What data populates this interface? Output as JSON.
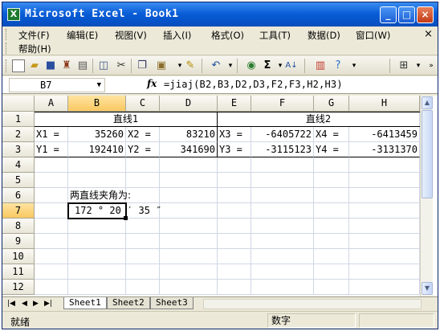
{
  "window": {
    "title": "Microsoft Excel - Book1",
    "app_icon": "X",
    "minimize_icon": "_",
    "maximize_icon": "□",
    "close_icon": "×"
  },
  "menubar": {
    "row1": [
      {
        "label": "文件(F)"
      },
      {
        "label": "编辑(E)"
      },
      {
        "label": "视图(V)"
      },
      {
        "label": "插入(I)"
      },
      {
        "label": "格式(O)"
      },
      {
        "label": "工具(T)"
      },
      {
        "label": "数据(D)"
      },
      {
        "label": "窗口(W)"
      }
    ],
    "row2": [
      {
        "label": "帮助(H)"
      }
    ],
    "close_doc": "×"
  },
  "toolbar": {
    "icons": [
      "new-icon",
      "open-icon",
      "save-icon",
      "permission-icon",
      "print-icon",
      "print-preview-icon",
      "research-icon",
      "copy-icon",
      "paste-icon",
      "format-painter-icon",
      "undo-icon",
      "hyperlink-icon",
      "autosum-icon",
      "sort-ascending-icon",
      "chart-wizard-icon",
      "help-icon",
      "borders-icon"
    ]
  },
  "formula_bar": {
    "name_box": "B7",
    "fx": "fx",
    "formula": "=jiaj(B2,B3,D2,D3,F2,F3,H2,H3)"
  },
  "grid": {
    "columns": [
      "A",
      "B",
      "C",
      "D",
      "E",
      "F",
      "G",
      "H"
    ],
    "rows": [
      "1",
      "2",
      "3",
      "4",
      "5",
      "6",
      "7",
      "8",
      "9",
      "10",
      "11",
      "12"
    ],
    "selected_column": "B",
    "selected_row": "7",
    "headers_row1": {
      "left": "直线1",
      "right": "直线2"
    },
    "row2": {
      "A": "X1 =",
      "B": "35260",
      "C": "X2 =",
      "D": "83210",
      "E": "X3 =",
      "F": "-6405722",
      "G": "X4 =",
      "H": "-6413459"
    },
    "row3": {
      "A": "Y1 =",
      "B": "192410",
      "C": "Y2 =",
      "D": "341690",
      "E": "Y3 =",
      "F": "-3115123",
      "G": "Y4 =",
      "H": "-3131370"
    },
    "row6_label": "两直线夹角为:",
    "row7_value": "172 °  20 ′ 35 ″"
  },
  "sheets": {
    "tabs": [
      "Sheet1",
      "Sheet2",
      "Sheet3"
    ],
    "active": "Sheet1",
    "nav": [
      "|◀",
      "◀",
      "▶",
      "▶|"
    ]
  },
  "status": {
    "left": "就绪",
    "numlock": "数字"
  }
}
